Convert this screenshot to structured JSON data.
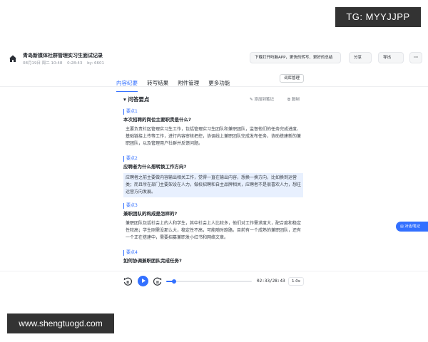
{
  "watermarks": {
    "top": "TG: MYYJJPP",
    "bottom": "www.shengtuogd.com"
  },
  "header": {
    "title": "青岛新媒体社群管理实习生面试记录",
    "date": "08月19日 周二 10:48",
    "duration": "0:28:43",
    "owner": "by: 6601",
    "app_banner": "下载打开听脑APP，更快的转写、更好的总结",
    "share_label": "分享",
    "export_label": "导出",
    "more_label": "···"
  },
  "tabs": [
    "内容纪要",
    "转写结果",
    "附件管理",
    "更多功能"
  ],
  "vocab_button": "词库管理",
  "section": {
    "title": "问答要点",
    "add_note": "添加到笔记",
    "copy": "复制"
  },
  "qa": [
    {
      "label": "要点1",
      "question": "本次招聘的岗位主要职责是什么?",
      "answer": "主要负责社区管理实习生工作，包括管理实习生团队和兼职团队，监督他们的任务完成进度、基础链接上传等工作，进行内容审核把控，协调线上兼职团队完成发布任务，协助搭建新的兼职团队，以及管理用户社群并反馈问题。"
    },
    {
      "label": "要点2",
      "question": "应聘者为什么想转换工作方向?",
      "answer": "应聘者之前主要做内容输出相关工作，觉得一直在输出内容，想换一换方向，比如换到运营类；而且所在部门主要架设在人力，做校招聘和自主品牌相关，应聘者不是很喜欢人力，想往运营方向发展。"
    },
    {
      "label": "要点3",
      "question": "兼职团队的构成是怎样的?",
      "answer": "兼职团队包括社会上的人和学生，其中社会上人比较多，他们对工作需求度大，配合度和稳定性较高；学生刚需没那么大，稳定性不高，可能随时跑路。目前有一个成熟的兼职团队，还有一个正在搭建中，需要招募兼职发小红书和网络文章。"
    },
    {
      "label": "要点4",
      "question": "如何协调兼职团队完成任务?",
      "answer": ""
    }
  ],
  "side_button": "对话/笔记",
  "player": {
    "time": "02:33/28:43",
    "speed": "1.0x",
    "progress": 0.089
  },
  "colors": {
    "accent": "#3370ff",
    "highlight": "#e8f0fe"
  }
}
